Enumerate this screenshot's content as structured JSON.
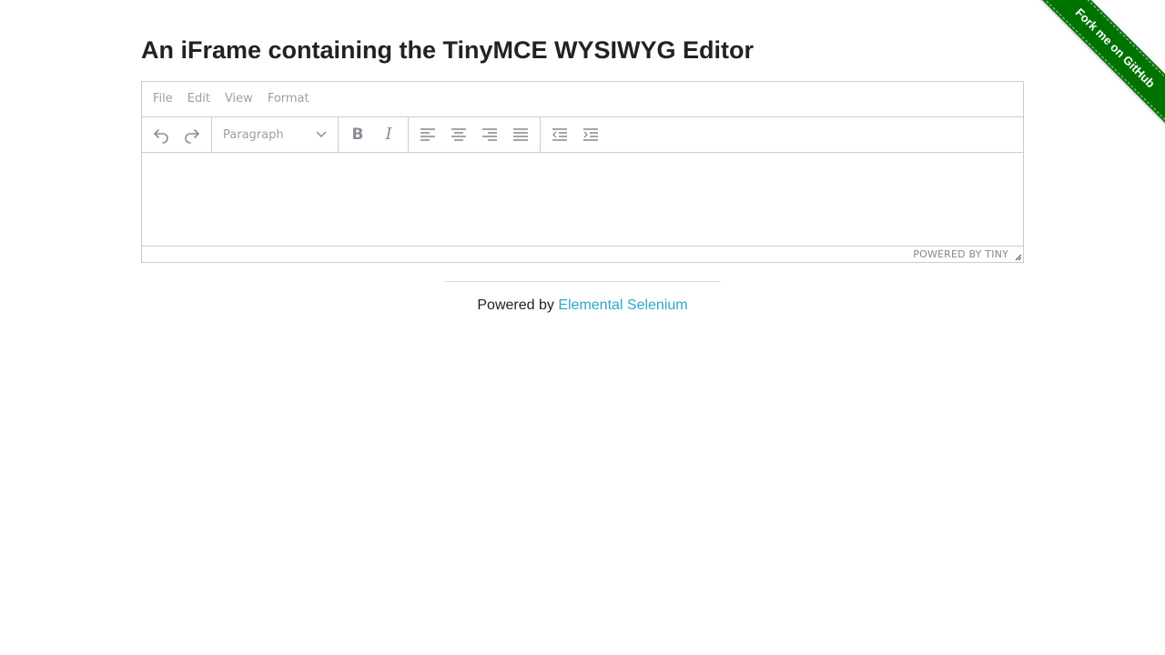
{
  "page": {
    "title": "An iFrame containing the TinyMCE WYSIWYG Editor"
  },
  "editor": {
    "menubar": [
      "File",
      "Edit",
      "View",
      "Format"
    ],
    "toolbar": {
      "format_select": "Paragraph",
      "bold_glyph": "B",
      "italic_glyph": "I",
      "icons": [
        "undo-icon",
        "redo-icon",
        "chevron-down-icon",
        "bold-icon",
        "italic-icon",
        "align-left-icon",
        "align-center-icon",
        "align-right-icon",
        "align-justify-icon",
        "outdent-icon",
        "indent-icon"
      ]
    },
    "content": "",
    "statusbar": {
      "branding": "POWERED BY TINY",
      "resize_icon": "resize-handle-icon"
    }
  },
  "footer": {
    "prefix": "Powered by ",
    "link_text": "Elemental Selenium",
    "link_color": "#2ba6cb"
  },
  "ribbon": {
    "text": "Fork me on GitHub",
    "color": "#007200"
  }
}
